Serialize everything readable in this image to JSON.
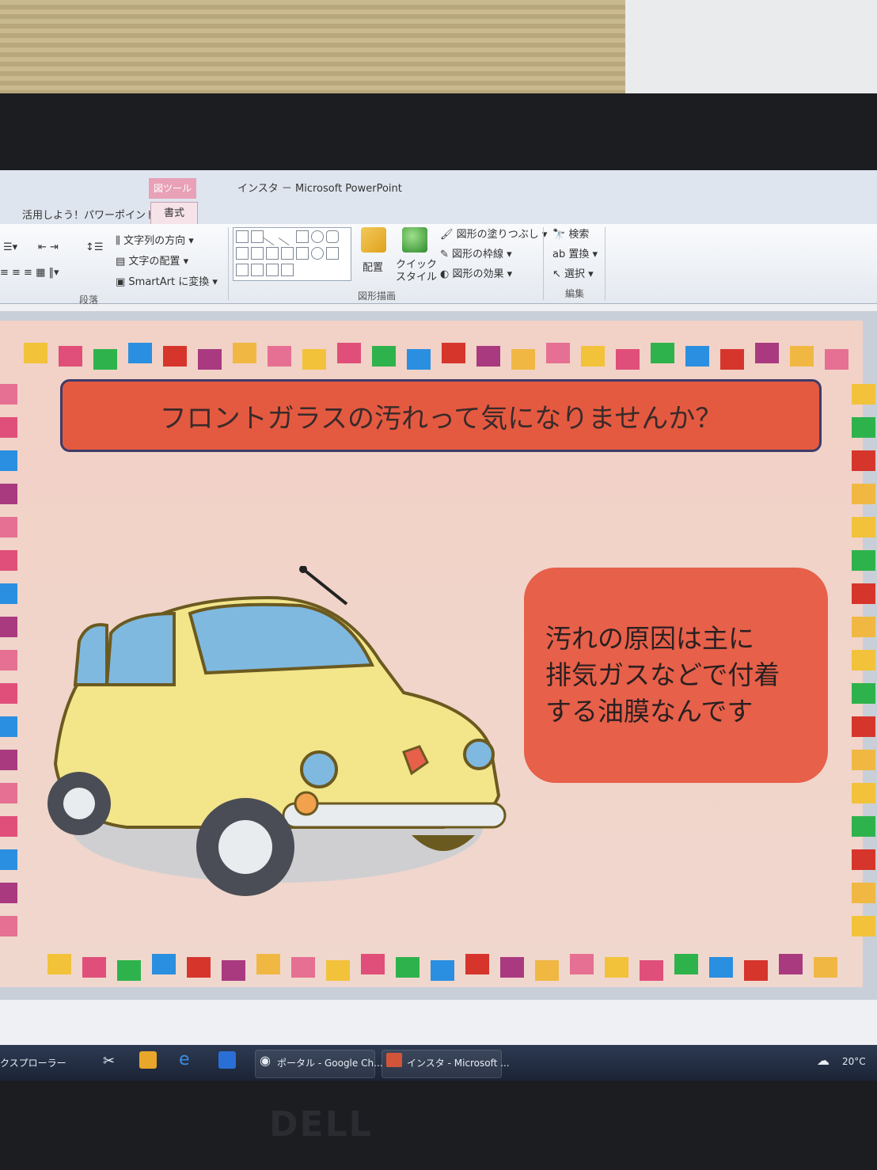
{
  "window": {
    "title": "インスタ － Microsoft PowerPoint",
    "context_tab_group": "図ツール",
    "tabs": [
      "活用しよう！パワーポイント",
      "書式"
    ]
  },
  "ribbon": {
    "paragraph": {
      "text_direction": "文字列の方向",
      "align_text": "文字の配置",
      "convert_smartart": "SmartArt に変換",
      "group_label": "段落"
    },
    "drawing": {
      "arrange": "配置",
      "quick_styles": "クイック\nスタイル",
      "shape_fill": "図形の塗りつぶし",
      "shape_outline": "図形の枠線",
      "shape_effects": "図形の効果",
      "group_label": "図形描画"
    },
    "editing": {
      "find": "検索",
      "replace": "置換",
      "select": "選択",
      "group_label": "編集"
    }
  },
  "slide": {
    "title": "フロントガラスの汚れって気になりませんか？",
    "callout_lines": [
      "汚れの原因は主に",
      "排気ガスなどで付着",
      "する油膜なんです"
    ]
  },
  "taskbar": {
    "items": [
      "クスプローラー",
      "ポータル - Google Ch...",
      "インスタ - Microsoft ..."
    ],
    "temperature": "20°C"
  },
  "monitor_brand": "DELL",
  "colors": {
    "banner": "#e45a40",
    "callout": "#e7604a",
    "car_body": "#f3e58a"
  }
}
